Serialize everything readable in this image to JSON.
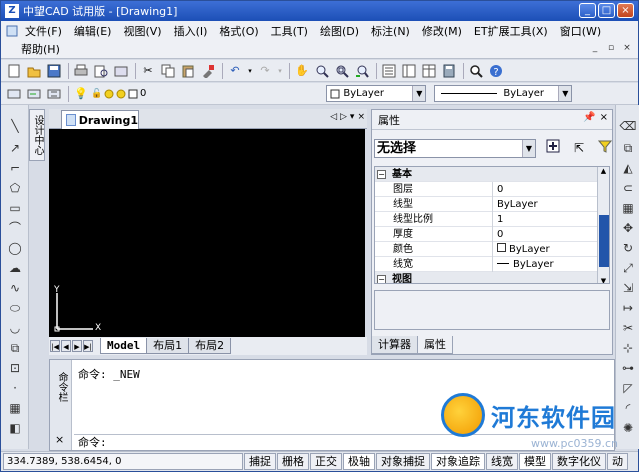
{
  "window": {
    "title": "中望CAD 试用版 - [Drawing1]",
    "buttons": [
      "_",
      "□",
      "×"
    ]
  },
  "menubar": {
    "row1": [
      "文件(F)",
      "编辑(E)",
      "视图(V)",
      "插入(I)",
      "格式(O)",
      "工具(T)",
      "绘图(D)",
      "标注(N)",
      "修改(M)",
      "ET扩展工具(X)",
      "窗口(W)"
    ],
    "row2": [
      "帮助(H)"
    ]
  },
  "toolbar2": {
    "layer_value": "0",
    "color_value": "ByLayer",
    "linetype_value": "ByLayer"
  },
  "palette_tab": "设计中心",
  "document": {
    "tab": "Drawing1",
    "axis_y": "Y",
    "axis_x": "X",
    "layout_tabs": [
      "Model",
      "布局1",
      "布局2"
    ]
  },
  "properties": {
    "title": "属性",
    "selection": "无选择",
    "categories": [
      {
        "name": "基本",
        "rows": [
          {
            "key": "图层",
            "value": "0"
          },
          {
            "key": "线型",
            "value": "ByLayer"
          },
          {
            "key": "线型比例",
            "value": "1"
          },
          {
            "key": "厚度",
            "value": "0"
          },
          {
            "key": "颜色",
            "value": "ByLayer"
          },
          {
            "key": "线宽",
            "value": "ByLayer"
          }
        ]
      },
      {
        "name": "视图",
        "rows": []
      }
    ],
    "tabs": [
      "计算器",
      "属性"
    ]
  },
  "command": {
    "side_label": "命令栏",
    "history": "命令: _NEW",
    "prompt": "命令:"
  },
  "watermark": {
    "text": "河东软件园",
    "url": "www.pc0359.cn"
  },
  "status": {
    "coords": "334.7389, 538.6454, 0",
    "buttons": [
      "捕捉",
      "栅格",
      "正交",
      "极轴",
      "对象捕捉",
      "对象追踪",
      "线宽",
      "模型",
      "数字化仪",
      "动"
    ]
  }
}
